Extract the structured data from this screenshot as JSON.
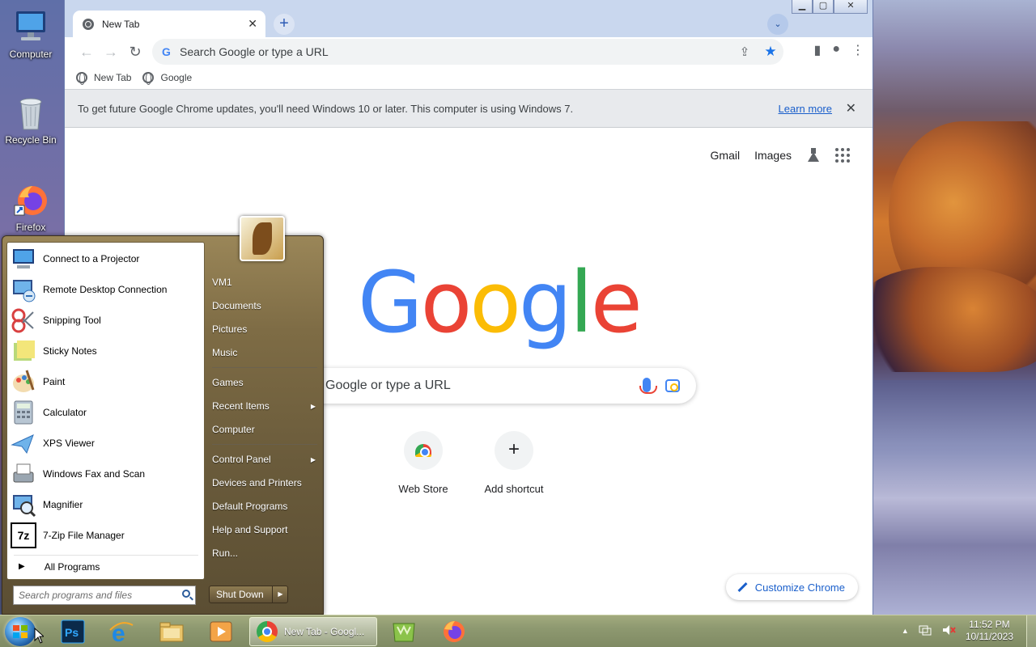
{
  "desktop": {
    "icons": [
      {
        "label": "Computer"
      },
      {
        "label": "Recycle Bin"
      },
      {
        "label": "Firefox"
      }
    ]
  },
  "browser": {
    "tab": {
      "title": "New Tab",
      "close": "✕"
    },
    "new_tab": "+",
    "tab_search": "⌄",
    "window_controls": {
      "minimize": "▁",
      "maximize": "▢",
      "close": "✕"
    },
    "nav": {
      "back": "←",
      "forward": "→",
      "reload": "↻"
    },
    "omnibox": {
      "placeholder": "Search Google or type a URL",
      "g": "G"
    },
    "bookmarks": [
      {
        "label": "New Tab"
      },
      {
        "label": "Google"
      }
    ],
    "infobar": {
      "message": "To get future Google Chrome updates, you'll need Windows 10 or later. This computer is using Windows 7.",
      "link": "Learn more",
      "close": "✕"
    },
    "ntp": {
      "links": {
        "gmail": "Gmail",
        "images": "Images"
      },
      "logo": [
        "G",
        "o",
        "o",
        "g",
        "l",
        "e"
      ],
      "logo_colors": [
        "#4285f4",
        "#ea4335",
        "#fbbc05",
        "#4285f4",
        "#34a853",
        "#ea4335"
      ],
      "search_placeholder": "Google or type a URL",
      "shortcuts": [
        {
          "label": "Web Store"
        },
        {
          "label": "Add shortcut",
          "icon": "+"
        }
      ],
      "customize": "Customize Chrome"
    }
  },
  "start_menu": {
    "programs": [
      {
        "label": "Connect to a Projector",
        "color": "#3a7fd0"
      },
      {
        "label": "Remote Desktop Connection",
        "color": "#2f6fb8"
      },
      {
        "label": "Snipping Tool",
        "color": "#d94040"
      },
      {
        "label": "Sticky Notes",
        "color": "#e3d86a"
      },
      {
        "label": "Paint",
        "color": "#e08a3a"
      },
      {
        "label": "Calculator",
        "color": "#8fa3b8"
      },
      {
        "label": "XPS Viewer",
        "color": "#4fa0d8"
      },
      {
        "label": "Windows Fax and Scan",
        "color": "#7a8896"
      },
      {
        "label": "Magnifier",
        "color": "#3b6fb5"
      },
      {
        "label": "7-Zip File Manager",
        "color": "#000000",
        "text": "7z"
      }
    ],
    "all_programs": "All Programs",
    "search_placeholder": "Search programs and files",
    "right": [
      {
        "label": "VM1"
      },
      {
        "label": "Documents"
      },
      {
        "label": "Pictures"
      },
      {
        "label": "Music"
      },
      {
        "label": "Games"
      },
      {
        "label": "Recent Items",
        "arrow": "▶"
      },
      {
        "label": "Computer"
      },
      {
        "label": "Control Panel",
        "arrow": "▶"
      },
      {
        "label": "Devices and Printers"
      },
      {
        "label": "Default Programs"
      },
      {
        "label": "Help and Support"
      },
      {
        "label": "Run..."
      }
    ],
    "shutdown": "Shut Down",
    "shutdown_arrow": "▶"
  },
  "taskbar": {
    "active_task": "New Tab - Googl...",
    "pinned": [
      {
        "name": "photoshop",
        "text": "Ps"
      },
      {
        "name": "internet-explorer",
        "text": "e"
      },
      {
        "name": "file-explorer"
      },
      {
        "name": "media-player"
      }
    ],
    "clock": {
      "time": "11:52 PM",
      "date": "10/11/2023"
    },
    "tray_arrow": "▲"
  }
}
